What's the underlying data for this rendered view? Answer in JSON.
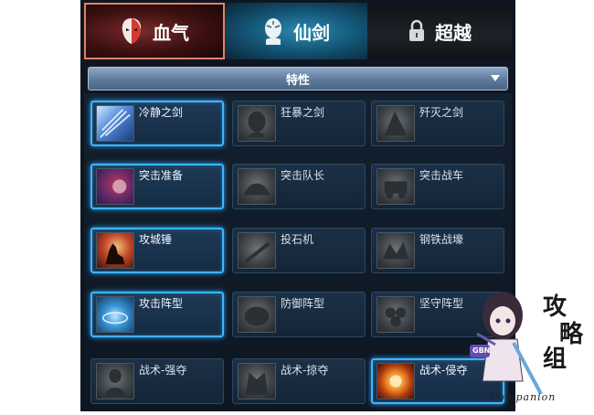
{
  "tabs": [
    {
      "label": "血气",
      "icon": "mask-icon",
      "active": true
    },
    {
      "label": "仙剑",
      "icon": "spirit-face-icon",
      "active": false
    },
    {
      "label": "超越",
      "icon": "lock-icon",
      "active": false
    }
  ],
  "trait_dropdown": {
    "label": "特性",
    "icon": "dropdown-arrow-icon"
  },
  "skills": [
    [
      {
        "name": "冷静之剑",
        "icon": "ice-sword-icon",
        "active": true
      },
      {
        "name": "狂暴之剑",
        "icon": "berserker-icon",
        "active": false
      },
      {
        "name": "歼灭之剑",
        "icon": "annihilation-icon",
        "active": false
      }
    ],
    [
      {
        "name": "突击准备",
        "icon": "assault-prep-icon",
        "active": true
      },
      {
        "name": "突击队长",
        "icon": "assault-captain-icon",
        "active": false
      },
      {
        "name": "突击战车",
        "icon": "assault-chariot-icon",
        "active": false
      }
    ],
    [
      {
        "name": "攻城锤",
        "icon": "wolf-howl-icon",
        "active": true
      },
      {
        "name": "投石机",
        "icon": "catapult-icon",
        "active": false
      },
      {
        "name": "钢铁战壕",
        "icon": "iron-trench-icon",
        "active": false
      }
    ],
    [
      {
        "name": "攻击阵型",
        "icon": "attack-formation-icon",
        "active": true
      },
      {
        "name": "防御阵型",
        "icon": "defense-formation-icon",
        "active": false
      },
      {
        "name": "坚守阵型",
        "icon": "hold-formation-icon",
        "active": false
      }
    ],
    [
      {
        "name": "战术-强夺",
        "icon": "tactic-seize-icon",
        "active": false
      },
      {
        "name": "战术-掠夺",
        "icon": "tactic-plunder-icon",
        "active": false
      },
      {
        "name": "战术-侵夺",
        "icon": "tactic-invade-icon",
        "active": true
      }
    ]
  ],
  "watermark": {
    "chars": [
      "攻",
      "略",
      "组"
    ],
    "text": "Companion",
    "badge": "GBN"
  }
}
